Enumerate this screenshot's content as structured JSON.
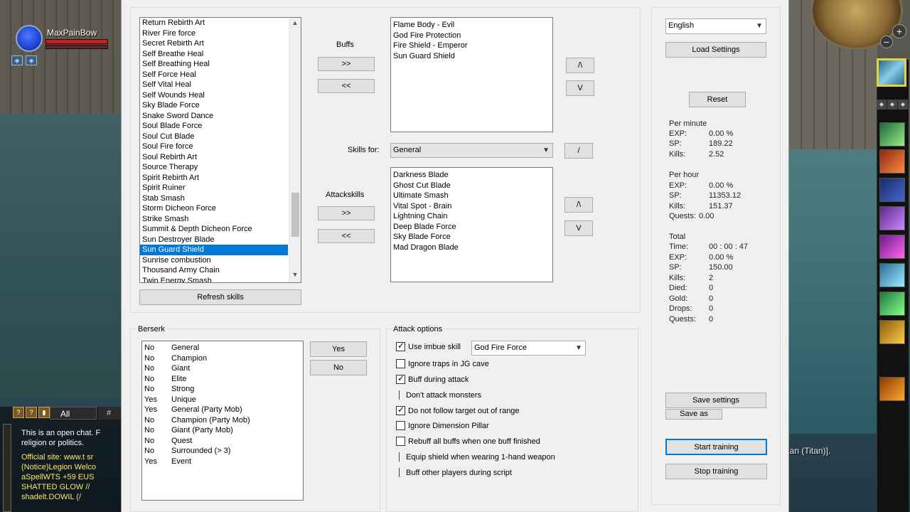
{
  "player": {
    "name": "MaxPainBow"
  },
  "chat": {
    "tab_all": "All",
    "tab_more": "#",
    "lines": [
      "This is an open chat. F",
      "religion or politics.",
      "Official site: www.t sr",
      "(Notice)Legion Welco",
      "aSpellWTS +59 EUS",
      "SHATTED GLOW //",
      "shadelt.DOWIL (/"
    ]
  },
  "party_label": "ultan (Titan)].",
  "skills_list": {
    "items": [
      "Return Rebirth Art",
      "River Fire force",
      "Secret Rebirth Art",
      "Self Breathe Heal",
      "Self Breathing Heal",
      "Self Force Heal",
      "Self Vital Heal",
      "Self Wounds Heal",
      "Sky Blade Force",
      "Snake Sword Dance",
      "Soul Blade Force",
      "Soul Cut Blade",
      "Soul Fire force",
      "Soul Rebirth Art",
      "Source Therapy",
      "Spirit Rebirth Art",
      "Spirit Ruiner",
      "Stab Smash",
      "Storm Dicheon Force",
      "Strike Smash",
      "Summit & Depth Dicheon Force",
      "Sun Destroyer Blade",
      "Sun Guard Shield",
      "Sunrise combustion",
      "Thousand Army Chain",
      "Twin Energy Smash"
    ],
    "selected_index": 22
  },
  "refresh_label": "Refresh skills",
  "buffs": {
    "label": "Buffs",
    "add": ">>",
    "remove": "<<",
    "items": [
      "Flame Body - Evil",
      "God Fire Protection",
      "Fire Shield - Emperor",
      "Sun Guard Shield"
    ],
    "up": "/\\",
    "down": "V"
  },
  "skills_for": {
    "label": "Skills for:",
    "value": "General",
    "edit": "/"
  },
  "attack_skills": {
    "label": "Attackskills",
    "add": ">>",
    "remove": "<<",
    "items": [
      "Darkness Blade",
      "Ghost Cut Blade",
      "Ultimate Smash",
      "Vital Spot - Brain",
      "Lightning Chain",
      "Deep Blade Force",
      "Sky Blade Force",
      "Mad Dragon Blade"
    ],
    "up": "/\\",
    "down": "V"
  },
  "settings": {
    "language": "English",
    "load": "Load Settings",
    "reset": "Reset",
    "save": "Save settings",
    "save_as": "Save as",
    "start": "Start training",
    "stop": "Stop training"
  },
  "stats": {
    "per_minute": {
      "title": "Per minute",
      "exp_k": "EXP:",
      "exp_v": "0.00 %",
      "sp_k": "SP:",
      "sp_v": "189.22",
      "kills_k": "Kills:",
      "kills_v": "2.52"
    },
    "per_hour": {
      "title": "Per hour",
      "exp_k": "EXP:",
      "exp_v": "0.00 %",
      "sp_k": "SP:",
      "sp_v": "11353.12",
      "kills_k": "Kills:",
      "kills_v": "151.37",
      "quests_k": "Quests:",
      "quests_v": "0.00"
    },
    "total": {
      "title": "Total",
      "time_k": "Time:",
      "time_v": "00 : 00 : 47",
      "exp_k": "EXP:",
      "exp_v": "0.00 %",
      "sp_k": "SP:",
      "sp_v": "150.00",
      "kills_k": "Kills:",
      "kills_v": "2",
      "died_k": "Died:",
      "died_v": "0",
      "gold_k": "Gold:",
      "gold_v": "0",
      "drops_k": "Drops:",
      "drops_v": "0",
      "quests_k": "Quests:",
      "quests_v": "0"
    }
  },
  "berserk": {
    "label": "Berserk",
    "rows": [
      [
        "No",
        "General"
      ],
      [
        "No",
        "Champion"
      ],
      [
        "No",
        "Giant"
      ],
      [
        "No",
        "Elite"
      ],
      [
        "No",
        "Strong"
      ],
      [
        "Yes",
        "Unique"
      ],
      [
        "Yes",
        "General (Party Mob)"
      ],
      [
        "No",
        "Champion (Party Mob)"
      ],
      [
        "No",
        "Giant (Party Mob)"
      ],
      [
        "No",
        "Quest"
      ],
      [
        "No",
        "Surrounded (> 3)"
      ],
      [
        "Yes",
        "Event"
      ]
    ],
    "yes": "Yes",
    "no": "No"
  },
  "attack_options": {
    "label": "Attack options",
    "imbue_skill": "God Fire Force",
    "options": [
      {
        "label": "Use imbue skill",
        "checked": true
      },
      {
        "label": "Ignore traps in JG cave",
        "checked": false
      },
      {
        "label": "Buff during attack",
        "checked": true
      },
      {
        "label": "Don't attack monsters",
        "checked": false
      },
      {
        "label": "Do not follow target out of range",
        "checked": true
      },
      {
        "label": "Ignore Dimension Pillar",
        "checked": false
      },
      {
        "label": "Rebuff all buffs when one buff finished",
        "checked": false
      },
      {
        "label": "Equip shield when wearing 1-hand weapon",
        "checked": false
      },
      {
        "label": "Buff other players during script",
        "checked": false
      }
    ]
  },
  "colors": {
    "selection": "#0078d7",
    "window_bg": "#f0f0f0"
  }
}
